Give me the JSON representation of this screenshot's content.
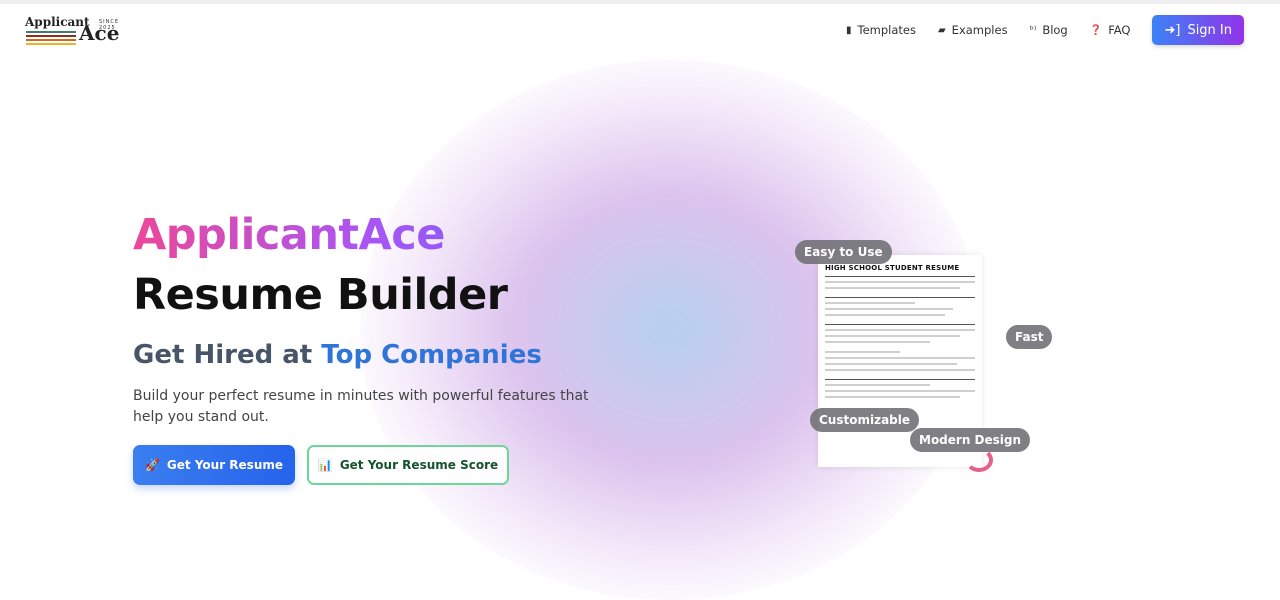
{
  "logo": {
    "text_top": "Applicant",
    "text_main": "Ace",
    "since": "SINCE 2025"
  },
  "nav": {
    "items": [
      {
        "icon": "file-icon",
        "label": "Templates"
      },
      {
        "icon": "book-icon",
        "label": "Examples"
      },
      {
        "icon": "blog-icon",
        "label": "Blog"
      },
      {
        "icon": "question-icon",
        "label": "FAQ"
      }
    ],
    "sign_in": "Sign In"
  },
  "hero": {
    "brand": "ApplicantAce",
    "title": "Resume Builder",
    "subtitle_prefix": "Get Hired at",
    "subtitle_highlight": "Top Companies",
    "description": "Build your perfect resume in minutes with powerful features that help you stand out.",
    "primary_button": "Get Your Resume",
    "secondary_button": "Get Your Resume Score"
  },
  "preview": {
    "resume_title": "HIGH SCHOOL STUDENT RESUME",
    "badges": [
      "Easy to Use",
      "Fast",
      "Customizable",
      "Modern Design"
    ]
  },
  "colors": {
    "accent": "#3b82f6",
    "brand_purple": "#9333ea",
    "pink": "#ec4899"
  }
}
